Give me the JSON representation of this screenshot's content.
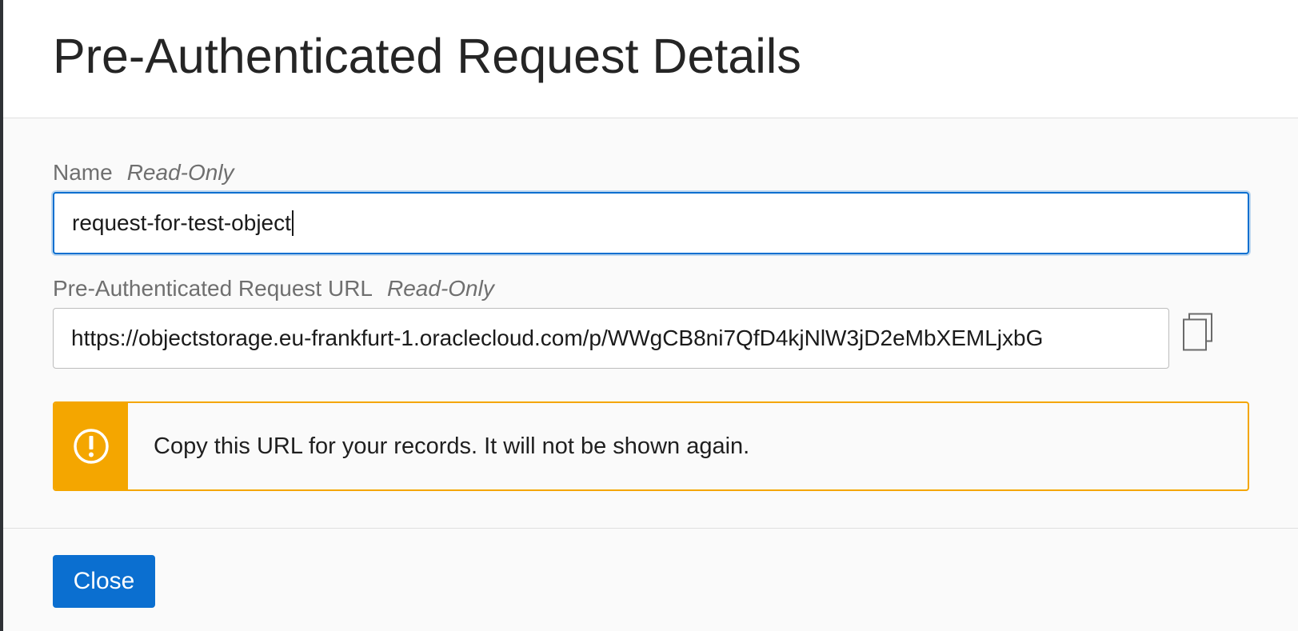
{
  "dialog": {
    "title": "Pre-Authenticated Request Details"
  },
  "name_field": {
    "label": "Name",
    "readonly_tag": "Read-Only",
    "value": "request-for-test-object"
  },
  "url_field": {
    "label": "Pre-Authenticated Request URL",
    "readonly_tag": "Read-Only",
    "value": "https://objectstorage.eu-frankfurt-1.oraclecloud.com/p/WWgCB8ni7QfD4kjNlW3jD2eMbXEMLjxbG",
    "copy_icon": "copy-icon"
  },
  "alert": {
    "icon": "warning-exclamation-icon",
    "message": "Copy this URL for your records. It will not be shown again.",
    "color": "#f4a600"
  },
  "footer": {
    "close_label": "Close"
  },
  "colors": {
    "accent": "#0b6fd0",
    "warning": "#f4a600"
  }
}
